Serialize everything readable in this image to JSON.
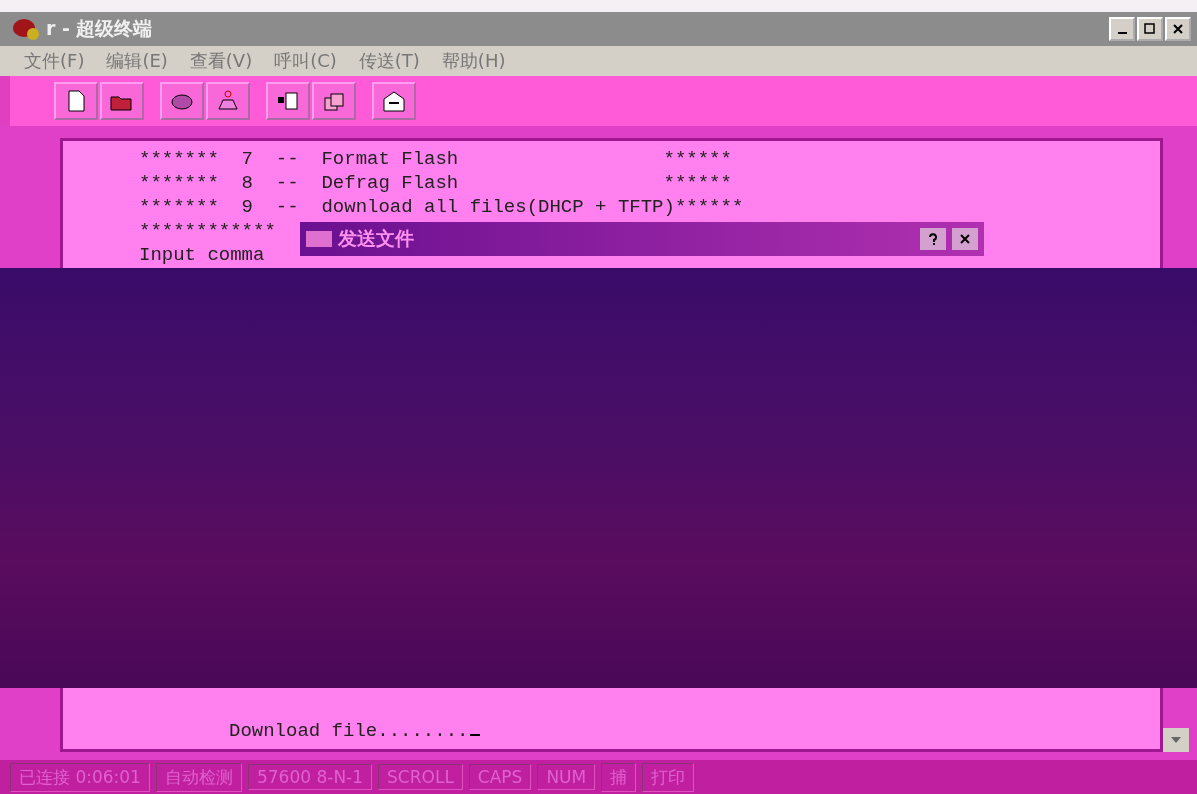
{
  "window": {
    "title": "r - 超级终端"
  },
  "menu": [
    "文件(F)",
    "编辑(E)",
    "查看(V)",
    "呼叫(C)",
    "传送(T)",
    "帮助(H)"
  ],
  "terminal": {
    "lines": [
      "*******  7  --  Format Flash                  ******",
      "*******  8  --  Defrag Flash                  ******",
      "*******  9  --  download all files(DHCP + TFTP)******",
      "************",
      "Input comma"
    ],
    "last_line": "Download file........"
  },
  "dialog": {
    "title": "发送文件"
  },
  "status_bar": [
    "已连接 0:06:01",
    "自动检测",
    "57600 8-N-1",
    "SCROLL",
    "CAPS",
    "NUM",
    "捕",
    "打印"
  ]
}
